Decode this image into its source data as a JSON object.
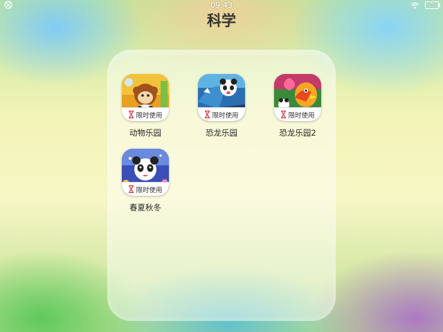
{
  "status_bar": {
    "time": "09:43"
  },
  "folder": {
    "title": "科学"
  },
  "badge_text": "限时使用",
  "apps": [
    {
      "label": "动物乐园",
      "icon": "monkey-panda-icon"
    },
    {
      "label": "恐龙乐园",
      "icon": "dinosaur-panda-icon"
    },
    {
      "label": "恐龙乐园2",
      "icon": "parrot-panda-icon"
    },
    {
      "label": "春夏秋冬",
      "icon": "panda-seasons-icon"
    }
  ],
  "colors": {
    "badge_hourglass": "#d9252d",
    "title": "#333333"
  }
}
